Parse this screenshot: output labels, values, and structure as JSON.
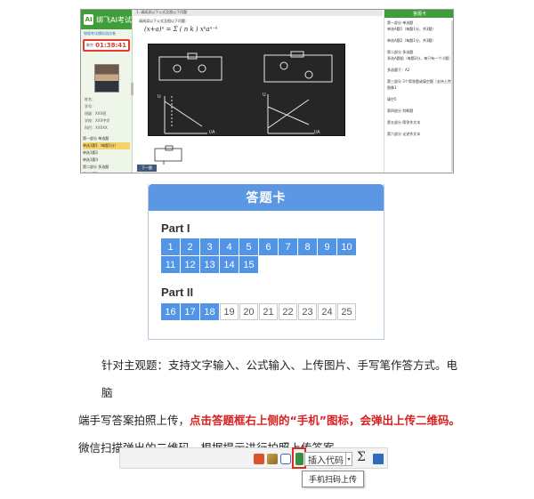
{
  "exam_screenshot": {
    "logo_text": "绑飞AI考试",
    "panel_title": "物理考试模拟测试卷",
    "timer_label": "剩余",
    "timer_value": "01:38:41",
    "info_lines": [
      "姓名：",
      "学号：",
      "班级：XXX班",
      "学校：XXX中学",
      "科目：XXXXX"
    ],
    "tree_items": [
      "第一部分 单选题",
      "单选1题1（每题1分）",
      "单选1题2",
      "单选1题3",
      "第二部分 多选题",
      "多选A题1",
      "第三部分 判断题",
      "图片",
      "填空"
    ],
    "question_header": "1. 请阅读以下公式及图以下问题",
    "question_text": "请阅读以下公式及图以下问题：",
    "formula": "(x+a)ⁿ = Σ ( n k ) xᵏaⁿ⁻ᵏ",
    "next_button": "下一题",
    "answer_panel_title": "答题卡",
    "answer_panel_lines": [
      "第一部分 单选题",
      "单选A题1（每题1分，共3题）",
      "",
      "单选A题2（每题1分，共3题）",
      "",
      "第二部分 多选题",
      "多选A题组（每题2分，每只有一个小题）",
      "",
      "多选题干：A2",
      "",
      "第三部分 3个简答题或填空题（支持上传图片）",
      "图像1",
      "",
      "填空5",
      "",
      "第四部分 判断题",
      "",
      "第五部分 简答作文本",
      "",
      "第六部分 论述作文本"
    ]
  },
  "answer_card": {
    "title": "答题卡",
    "parts": [
      {
        "name": "Part I",
        "items": [
          {
            "n": "1",
            "answered": true
          },
          {
            "n": "2",
            "answered": true
          },
          {
            "n": "3",
            "answered": true
          },
          {
            "n": "4",
            "answered": true
          },
          {
            "n": "5",
            "answered": true
          },
          {
            "n": "6",
            "answered": true
          },
          {
            "n": "7",
            "answered": true
          },
          {
            "n": "8",
            "answered": true
          },
          {
            "n": "9",
            "answered": true
          },
          {
            "n": "10",
            "answered": true
          },
          {
            "n": "11",
            "answered": true
          },
          {
            "n": "12",
            "answered": true
          },
          {
            "n": "13",
            "answered": true
          },
          {
            "n": "14",
            "answered": true
          },
          {
            "n": "15",
            "answered": true
          }
        ]
      },
      {
        "name": "Part II",
        "items": [
          {
            "n": "16",
            "answered": true
          },
          {
            "n": "17",
            "answered": true
          },
          {
            "n": "18",
            "answered": true
          },
          {
            "n": "19",
            "answered": false
          },
          {
            "n": "20",
            "answered": false
          },
          {
            "n": "21",
            "answered": false
          },
          {
            "n": "22",
            "answered": false
          },
          {
            "n": "23",
            "answered": false
          },
          {
            "n": "24",
            "answered": false
          },
          {
            "n": "25",
            "answered": false
          }
        ]
      }
    ],
    "colors": {
      "answered": "#5294e6",
      "unanswered": "#ffffff",
      "header": "#5b97e3"
    }
  },
  "paragraph": {
    "line1": "针对主观题：支持文字输入、公式输入、上传图片、手写笔作答方式。电脑",
    "line2_prefix": "端手写答案拍照上传，",
    "line2_red": "点击答题框右上侧的“手机”图标，会弹出上传二维码。",
    "line3": "微信扫描弹出的二维码，根据提示进行拍照上传答案。",
    "highlight_color": "#d92020"
  },
  "toolbar": {
    "icons": [
      "image-icon",
      "brush-icon",
      "camera-icon",
      "phone-icon"
    ],
    "insert_code_label": "插入代码",
    "sigma_label": "Σ",
    "tooltip": "手机扫码上传"
  }
}
